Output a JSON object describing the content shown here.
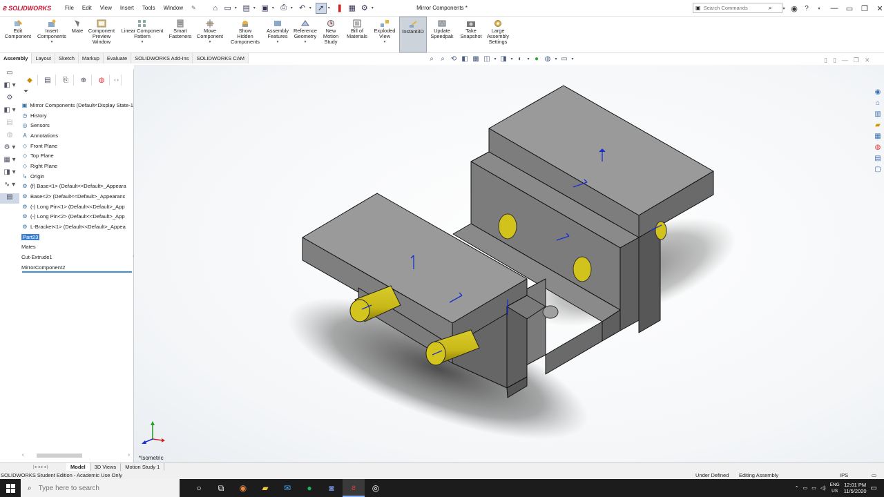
{
  "app": {
    "logo_text": "SOLIDWORKS",
    "document_title": "Mirror Components *",
    "brand_color": "#c8102e"
  },
  "menu": [
    "File",
    "Edit",
    "View",
    "Insert",
    "Tools",
    "Window"
  ],
  "search": {
    "placeholder": "Search Commands"
  },
  "command_manager": [
    {
      "label": "Edit\nComponent",
      "icon": "edit-component-icon"
    },
    {
      "label": "Insert\nComponents",
      "icon": "insert-components-icon"
    },
    {
      "label": "Mate",
      "icon": "mate-icon"
    },
    {
      "label": "Component\nPreview\nWindow",
      "icon": "preview-window-icon"
    },
    {
      "label": "Linear Component\nPattern",
      "icon": "pattern-icon"
    },
    {
      "label": "Smart\nFasteners",
      "icon": "fastener-icon"
    },
    {
      "label": "Move\nComponent",
      "icon": "move-icon"
    },
    {
      "label": "Show\nHidden\nComponents",
      "icon": "show-hidden-icon"
    },
    {
      "label": "Assembly\nFeatures",
      "icon": "assembly-features-icon"
    },
    {
      "label": "Reference\nGeometry",
      "icon": "reference-geometry-icon"
    },
    {
      "label": "New\nMotion\nStudy",
      "icon": "motion-study-icon"
    },
    {
      "label": "Bill of\nMaterials",
      "icon": "bom-icon"
    },
    {
      "label": "Exploded\nView",
      "icon": "exploded-view-icon"
    },
    {
      "label": "Instant3D",
      "icon": "instant3d-icon"
    },
    {
      "label": "Update\nSpeedpak",
      "icon": "speedpak-icon"
    },
    {
      "label": "Take\nSnapshot",
      "icon": "snapshot-icon"
    },
    {
      "label": "Large\nAssembly\nSettings",
      "icon": "large-assembly-icon"
    }
  ],
  "tabs": [
    "Assembly",
    "Layout",
    "Sketch",
    "Markup",
    "Evaluate",
    "SOLIDWORKS Add-Ins",
    "SOLIDWORKS CAM"
  ],
  "tree": [
    {
      "label": "Mirror Components  (Default<Display State-1",
      "icon": "assembly-icon"
    },
    {
      "label": "History",
      "icon": "history-icon"
    },
    {
      "label": "Sensors",
      "icon": "sensor-icon"
    },
    {
      "label": "Annotations",
      "icon": "annotations-icon"
    },
    {
      "label": "Front Plane",
      "icon": "plane-icon"
    },
    {
      "label": "Top Plane",
      "icon": "plane-icon"
    },
    {
      "label": "Right Plane",
      "icon": "plane-icon"
    },
    {
      "label": "Origin",
      "icon": "origin-icon"
    },
    {
      "label": "(f) Base<1> (Default<<Default>_Appeara",
      "icon": "part-icon"
    },
    {
      "label": "Base<2> (Default<<Default>_Appearanc",
      "icon": "part-icon"
    },
    {
      "label": "(-) Long Pin<1> (Default<<Default>_App",
      "icon": "part-icon"
    },
    {
      "label": "(-) Long Pin<2> (Default<<Default>_App",
      "icon": "part-icon"
    },
    {
      "label": "L-Bracket<1> (Default<<Default>_Appea",
      "icon": "part-icon"
    },
    {
      "label": "Part23",
      "icon": "part-icon",
      "selected": true
    },
    {
      "label": "Mates",
      "icon": "mates-icon"
    },
    {
      "label": "Cut-Extrude1",
      "icon": "cut-extrude-icon"
    },
    {
      "label": "MirrorComponent2",
      "icon": "mirror-icon"
    }
  ],
  "view": {
    "label": "*Isometric"
  },
  "bottom_tabs": [
    "Model",
    "3D Views",
    "Motion Study 1"
  ],
  "status": {
    "edition": "SOLIDWORKS Student Edition - Academic Use Only",
    "state": "Under Defined",
    "mode": "Editing Assembly",
    "units": "IPS"
  },
  "taskbar": {
    "search_placeholder": "Type here to search",
    "lang_line1": "ENG",
    "lang_line2": "US",
    "time": "12:01 PM",
    "date": "11/5/2020"
  }
}
